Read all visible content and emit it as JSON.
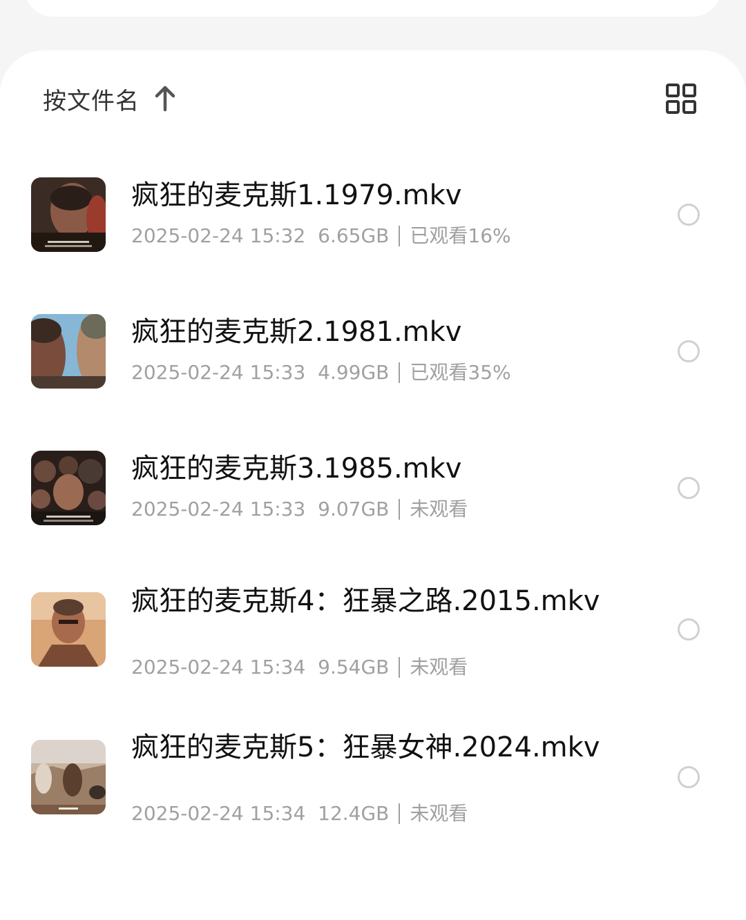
{
  "sort": {
    "label": "按文件名",
    "direction": "ascending",
    "arrow_icon": "arrow-up-icon"
  },
  "view_toggle": {
    "icon": "grid-view-icon"
  },
  "files": [
    {
      "name": "疯狂的麦克斯1.1979.mkv",
      "date": "2025-02-24 15:32",
      "size": "6.65GB",
      "status": "已观看16%",
      "thumb_icon": "movie-thumbnail-icon"
    },
    {
      "name": "疯狂的麦克斯2.1981.mkv",
      "date": "2025-02-24 15:33",
      "size": "4.99GB",
      "status": "已观看35%",
      "thumb_icon": "movie-thumbnail-icon"
    },
    {
      "name": "疯狂的麦克斯3.1985.mkv",
      "date": "2025-02-24 15:33",
      "size": "9.07GB",
      "status": "未观看",
      "thumb_icon": "movie-thumbnail-icon"
    },
    {
      "name": "疯狂的麦克斯4：狂暴之路.2015.mkv",
      "date": "2025-02-24 15:34",
      "size": "9.54GB",
      "status": "未观看",
      "thumb_icon": "movie-thumbnail-icon"
    },
    {
      "name": "疯狂的麦克斯5：狂暴女神.2024.mkv",
      "date": "2025-02-24 15:34",
      "size": "12.4GB",
      "status": "未观看",
      "thumb_icon": "movie-thumbnail-icon"
    }
  ],
  "colors": {
    "background": "#f5f5f5",
    "card": "#ffffff",
    "title": "#111111",
    "meta": "#a0a0a0",
    "radio_border": "#d0d0d0"
  }
}
